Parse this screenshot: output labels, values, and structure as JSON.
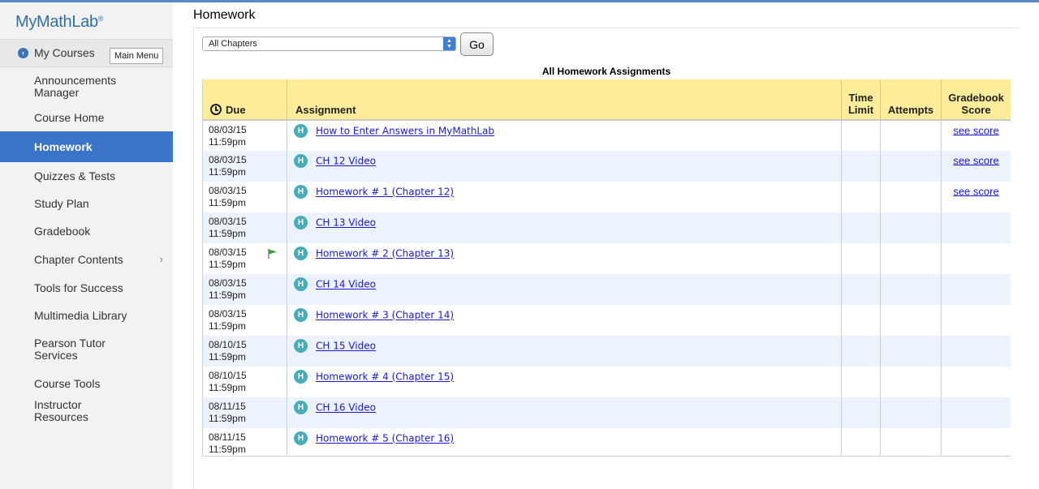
{
  "brand": {
    "logo": "MyMathLab",
    "logo_mark": "®"
  },
  "nav": {
    "back_glyph": "‹",
    "my_courses": "My Courses",
    "tooltip": "Main Menu",
    "items": [
      {
        "label": "Announcements Manager",
        "active": false,
        "has_submenu": false
      },
      {
        "label": "Course Home",
        "active": false,
        "has_submenu": false
      },
      {
        "label": "Homework",
        "active": true,
        "has_submenu": false
      },
      {
        "label": "Quizzes & Tests",
        "active": false,
        "has_submenu": false
      },
      {
        "label": "Study Plan",
        "active": false,
        "has_submenu": false
      },
      {
        "label": "Gradebook",
        "active": false,
        "has_submenu": false
      },
      {
        "label": "Chapter Contents",
        "active": false,
        "has_submenu": true
      },
      {
        "label": "Tools for Success",
        "active": false,
        "has_submenu": false
      },
      {
        "label": "Multimedia Library",
        "active": false,
        "has_submenu": false
      },
      {
        "label": "Pearson Tutor Services",
        "active": false,
        "has_submenu": false
      },
      {
        "label": "Course Tools",
        "active": false,
        "has_submenu": false
      },
      {
        "label": "Instructor Resources",
        "active": false,
        "has_submenu": false
      }
    ]
  },
  "page": {
    "title": "Homework",
    "filter": {
      "selected": "All Chapters",
      "go_label": "Go"
    },
    "table_title": "All Homework Assignments",
    "columns": {
      "due": "Due",
      "assignment": "Assignment",
      "time_limit": "Time Limit",
      "attempts": "Attempts",
      "score": "Gradebook Score"
    },
    "rows": [
      {
        "date": "08/03/15",
        "time": "11:59pm",
        "type_badge": "H",
        "title": "How to Enter Answers in MyMathLab",
        "flag": false,
        "time_limit": "",
        "attempts": "",
        "score": "see score"
      },
      {
        "date": "08/03/15",
        "time": "11:59pm",
        "type_badge": "H",
        "title": "CH 12 Video",
        "flag": false,
        "time_limit": "",
        "attempts": "",
        "score": "see score"
      },
      {
        "date": "08/03/15",
        "time": "11:59pm",
        "type_badge": "H",
        "title": "Homework # 1 (Chapter 12)",
        "flag": false,
        "time_limit": "",
        "attempts": "",
        "score": "see score"
      },
      {
        "date": "08/03/15",
        "time": "11:59pm",
        "type_badge": "H",
        "title": "CH 13 Video",
        "flag": false,
        "time_limit": "",
        "attempts": "",
        "score": ""
      },
      {
        "date": "08/03/15",
        "time": "11:59pm",
        "type_badge": "H",
        "title": "Homework # 2 (Chapter 13)",
        "flag": true,
        "time_limit": "",
        "attempts": "",
        "score": ""
      },
      {
        "date": "08/03/15",
        "time": "11:59pm",
        "type_badge": "H",
        "title": "CH 14 Video",
        "flag": false,
        "time_limit": "",
        "attempts": "",
        "score": ""
      },
      {
        "date": "08/03/15",
        "time": "11:59pm",
        "type_badge": "H",
        "title": "Homework # 3 (Chapter 14)",
        "flag": false,
        "time_limit": "",
        "attempts": "",
        "score": ""
      },
      {
        "date": "08/10/15",
        "time": "11:59pm",
        "type_badge": "H",
        "title": "CH 15 Video",
        "flag": false,
        "time_limit": "",
        "attempts": "",
        "score": ""
      },
      {
        "date": "08/10/15",
        "time": "11:59pm",
        "type_badge": "H",
        "title": "Homework # 4 (Chapter 15)",
        "flag": false,
        "time_limit": "",
        "attempts": "",
        "score": ""
      },
      {
        "date": "08/11/15",
        "time": "11:59pm",
        "type_badge": "H",
        "title": "CH 16 Video",
        "flag": false,
        "time_limit": "",
        "attempts": "",
        "score": ""
      },
      {
        "date": "08/11/15",
        "time": "11:59pm",
        "type_badge": "H",
        "title": "Homework # 5 (Chapter 16)",
        "flag": false,
        "time_limit": "",
        "attempts": "",
        "score": ""
      }
    ]
  },
  "colors": {
    "accent": "#3a74c8",
    "header_yellow": "#fdec9a",
    "alt_row": "#edf3fc",
    "badge": "#45aeb9",
    "link": "#1a1ad6",
    "flag": "#3aa63a"
  },
  "icons": {
    "back": "chevron-left-circle-icon",
    "submenu": "chevron-right-icon",
    "due": "clock-icon",
    "badge": "homework-badge-icon",
    "flag": "flag-icon",
    "select": "select-arrows-icon"
  }
}
